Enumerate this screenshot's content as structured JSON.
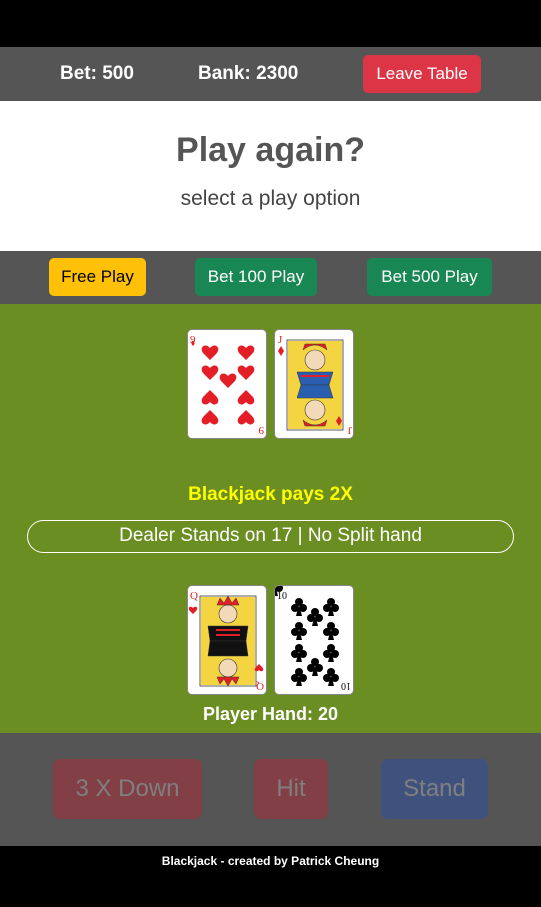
{
  "header": {
    "bet_label": "Bet: 500",
    "bank_label": "Bank: 2300",
    "leave_label": "Leave Table"
  },
  "prompt": {
    "title": "Play again?",
    "subtitle": "select a play option"
  },
  "play_options": {
    "free_label": "Free Play",
    "bet100_label": "Bet 100 Play",
    "bet500_label": "Bet 500 Play"
  },
  "dealer": {
    "cards": [
      {
        "rank": "9",
        "suit": "hearts"
      },
      {
        "rank": "J",
        "suit": "diamonds"
      }
    ]
  },
  "table": {
    "pays_text": "Blackjack pays 2X",
    "rules_text": "Dealer Stands on 17 | No Split hand"
  },
  "player": {
    "cards": [
      {
        "rank": "Q",
        "suit": "hearts"
      },
      {
        "rank": "10",
        "suit": "clubs"
      }
    ],
    "total_label": "Player Hand: 20"
  },
  "actions": {
    "down_label": "3 X Down",
    "hit_label": "Hit",
    "stand_label": "Stand"
  },
  "footer": {
    "credit": "Blackjack - created by Patrick Cheung"
  },
  "colors": {
    "felt": "#6b8e23",
    "bar": "#555555",
    "danger": "#dc3545",
    "warning": "#ffc107",
    "success": "#198754",
    "primary": "#2a4fa5",
    "pays": "#ffff00"
  }
}
